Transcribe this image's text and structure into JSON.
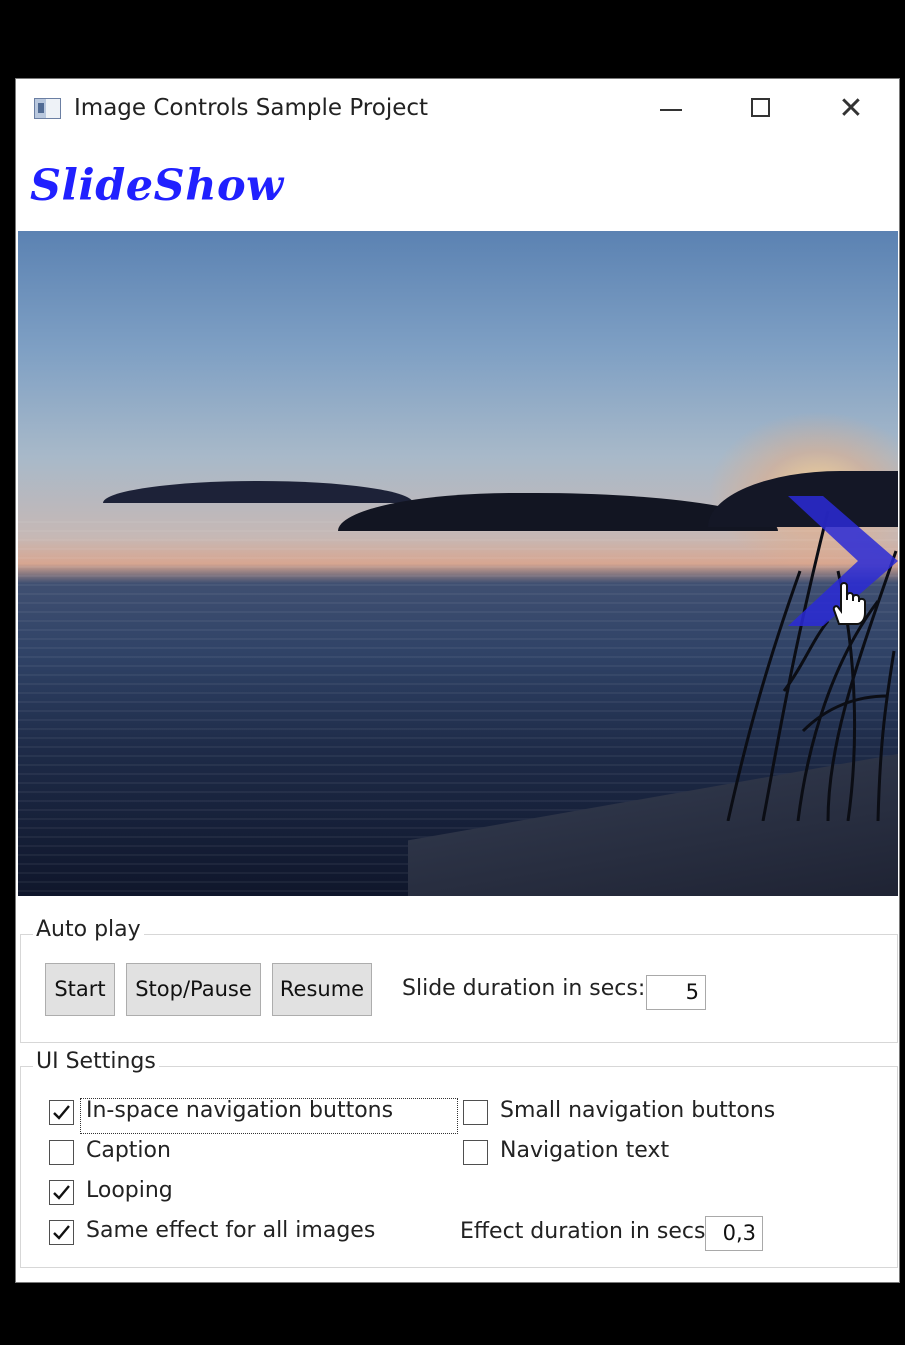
{
  "window": {
    "title": "Image Controls Sample Project",
    "controls": {
      "minimize": "minimize",
      "maximize": "maximize",
      "close": "✕"
    }
  },
  "header": {
    "title": "SlideShow",
    "title_color": "#2020ff"
  },
  "slide": {
    "arrow_color": "#2a2ad6"
  },
  "autoplay": {
    "legend": "Auto play",
    "start_label": "Start",
    "stop_label": "Stop/Pause",
    "resume_label": "Resume",
    "duration_label": "Slide duration in secs:",
    "duration_value": "5"
  },
  "ui_settings": {
    "legend": "UI Settings",
    "checkboxes": [
      {
        "label": "In-space navigation buttons",
        "checked": true
      },
      {
        "label": "Small navigation buttons",
        "checked": false
      },
      {
        "label": "Caption",
        "checked": false
      },
      {
        "label": "Navigation text",
        "checked": false
      },
      {
        "label": "Looping",
        "checked": true
      },
      {
        "label": "Same effect for all images",
        "checked": true
      }
    ],
    "effect_label": "Effect duration in secs:",
    "effect_value": "0,3"
  }
}
